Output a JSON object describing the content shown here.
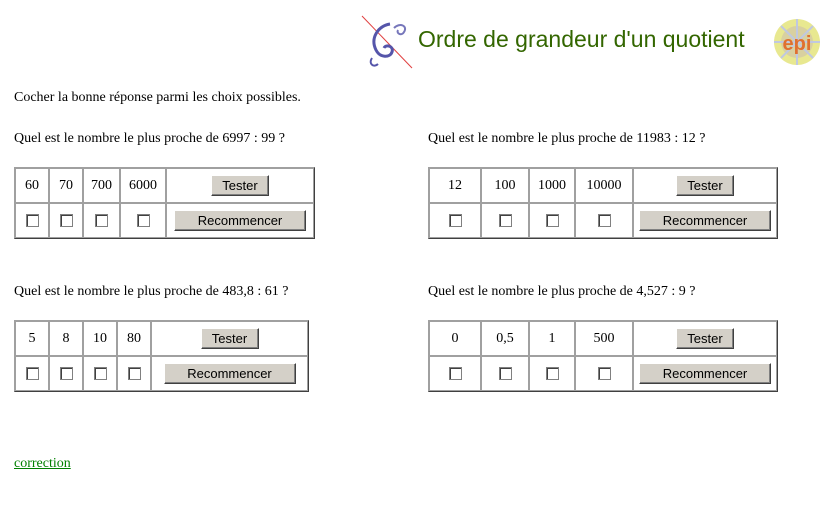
{
  "header": {
    "title": "Ordre de grandeur d'un quotient",
    "logo_icon": "epi-logo-icon",
    "decoration_icon": "swirl-decoration-icon",
    "title_color": "#336600"
  },
  "instruction": "Cocher la bonne réponse parmi les choix possibles.",
  "questions": [
    {
      "prompt": "Quel est le nombre le plus proche de 6997 : 99 ?",
      "choices": [
        "60",
        "70",
        "700",
        "6000"
      ],
      "test_label": "Tester",
      "reset_label": "Recommencer"
    },
    {
      "prompt": "Quel est le nombre le plus proche de 11983 : 12 ?",
      "choices": [
        "12",
        "100",
        "1000",
        "10000"
      ],
      "test_label": "Tester",
      "reset_label": "Recommencer"
    },
    {
      "prompt": "Quel est le nombre le plus proche de 483,8 : 61 ?",
      "choices": [
        "5",
        "8",
        "10",
        "80"
      ],
      "test_label": "Tester",
      "reset_label": "Recommencer"
    },
    {
      "prompt": "Quel est le nombre le plus proche de 4,527 : 9 ?",
      "choices": [
        "0",
        "0,5",
        "1",
        "500"
      ],
      "test_label": "Tester",
      "reset_label": "Recommencer"
    }
  ],
  "correction_link": "correction",
  "colors": {
    "link": "#008000",
    "button_face": "#d4d0c8"
  }
}
